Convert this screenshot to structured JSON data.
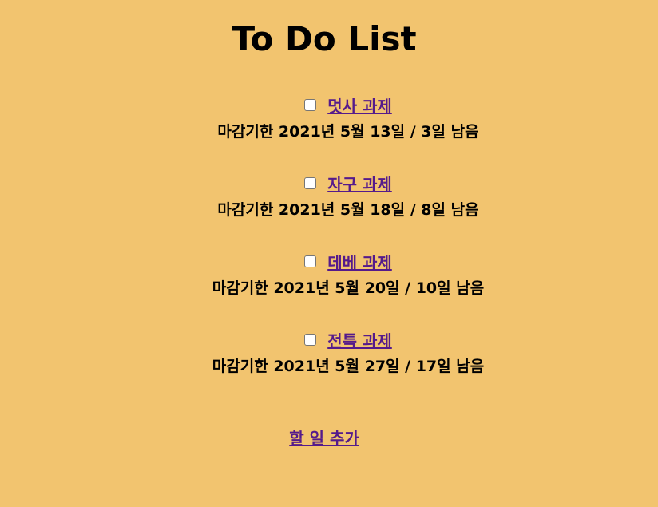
{
  "title": "To Do List",
  "items": [
    {
      "task": "멋사 과제",
      "deadline": "마감기한 2021년 5월 13일 / 3일 남음"
    },
    {
      "task": "자구 과제",
      "deadline": "마감기한 2021년 5월 18일 / 8일 남음"
    },
    {
      "task": "데베 과제",
      "deadline": "마감기한 2021년 5월 20일 / 10일 남음"
    },
    {
      "task": "전특 과제",
      "deadline": "마감기한 2021년 5월 27일 / 17일 남음"
    }
  ],
  "add_label": "할 일 추가",
  "colors": {
    "background": "#f2c46f",
    "link": "#551a8b"
  }
}
